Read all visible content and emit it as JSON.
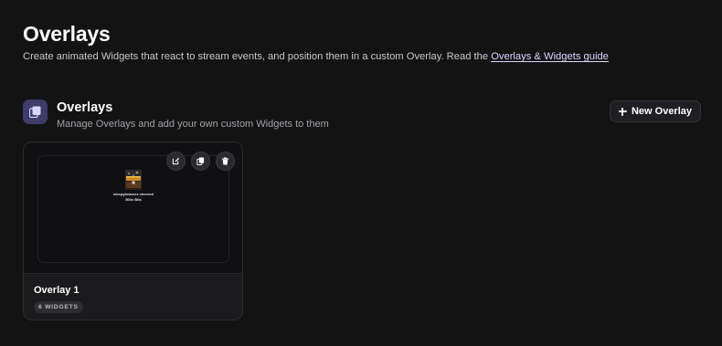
{
  "header": {
    "title": "Overlays",
    "subtitle": "Create animated Widgets that react to stream events, and position them in a custom Overlay. Read the ",
    "guide_link": "Overlays & Widgets guide"
  },
  "section": {
    "icon": "overlays-stack-icon",
    "title": "Overlays",
    "description": "Manage Overlays and add your own custom Widgets to them",
    "new_button_label": "New Overlay"
  },
  "overlays": [
    {
      "name": "Overlay 1",
      "widgets_badge": "6 WIDGETS",
      "preview_alert_text": "sleepybeaverz cheered 500x Bits",
      "actions": [
        "edit-icon",
        "duplicate-icon",
        "delete-icon"
      ]
    }
  ],
  "colors": {
    "background": "#131313",
    "card": "#1b1b1e",
    "accent_icon_bg": "#3f3b6a",
    "link": "#d9d6ff"
  }
}
